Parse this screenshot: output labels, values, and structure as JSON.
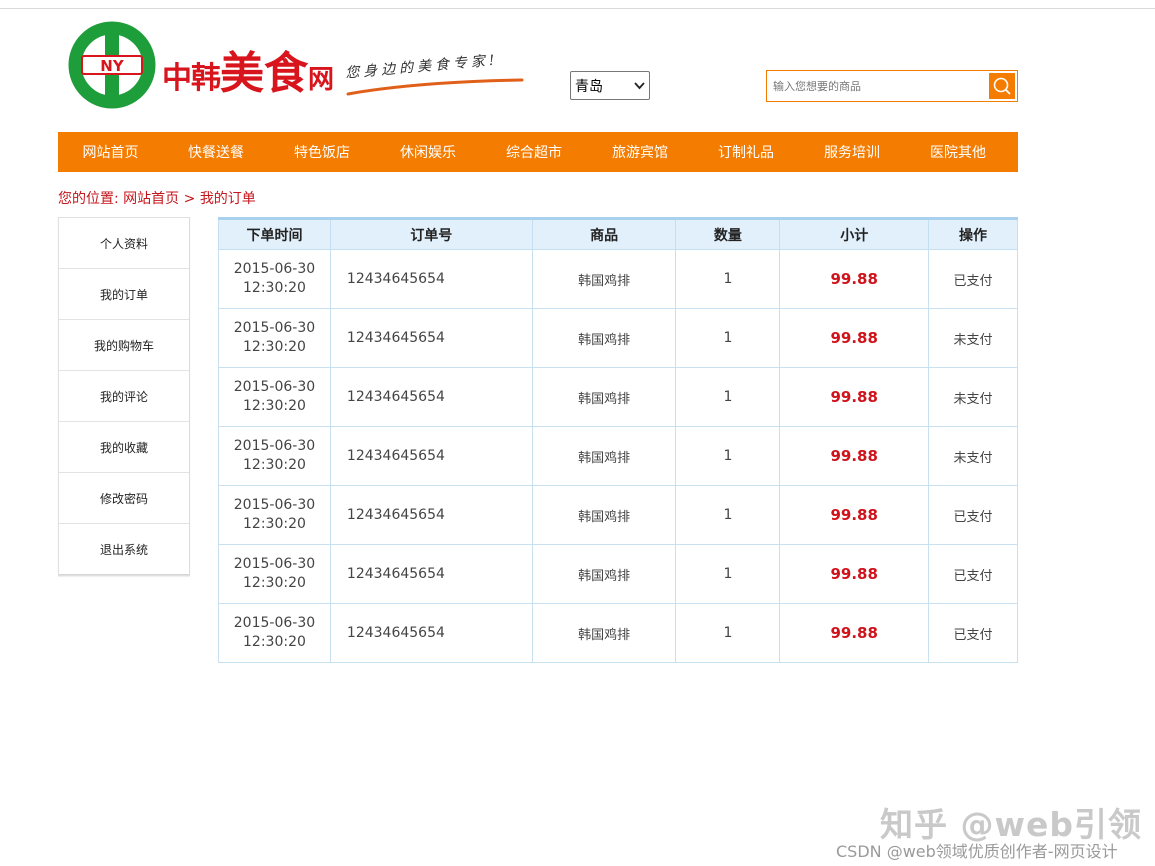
{
  "header": {
    "brand_part1": "中韩",
    "brand_part2": "美食",
    "brand_part3": "网",
    "logo_text": "NY",
    "slogan": "您身边的美食专家!",
    "city_selected": "青岛",
    "search_placeholder": "输入您想要的商品",
    "colors": {
      "brand_red": "#d8141c",
      "logo_green": "#1e9e3a",
      "accent_orange": "#f47c00"
    }
  },
  "nav": {
    "items": [
      "网站首页",
      "快餐送餐",
      "特色饭店",
      "休闲娱乐",
      "综合超市",
      "旅游宾馆",
      "订制礼品",
      "服务培训",
      "医院其他"
    ]
  },
  "breadcrumb": {
    "prefix": "您的位置:",
    "home": "网站首页",
    "separator": ">",
    "current": "我的订单"
  },
  "sidebar": {
    "items": [
      "个人资料",
      "我的订单",
      "我的购物车",
      "我的评论",
      "我的收藏",
      "修改密码",
      "退出系统"
    ]
  },
  "orders": {
    "headers": [
      "下单时间",
      "订单号",
      "商品",
      "数量",
      "小计",
      "操作"
    ],
    "rows": [
      {
        "date": "2015-06-30",
        "time": "12:30:20",
        "order_no": "12434645654",
        "goods": "韩国鸡排",
        "qty": "1",
        "subtotal": "99.88",
        "status": "已支付",
        "status_type": "paid"
      },
      {
        "date": "2015-06-30",
        "time": "12:30:20",
        "order_no": "12434645654",
        "goods": "韩国鸡排",
        "qty": "1",
        "subtotal": "99.88",
        "status": "未支付",
        "status_type": "unpaid"
      },
      {
        "date": "2015-06-30",
        "time": "12:30:20",
        "order_no": "12434645654",
        "goods": "韩国鸡排",
        "qty": "1",
        "subtotal": "99.88",
        "status": "未支付",
        "status_type": "unpaid"
      },
      {
        "date": "2015-06-30",
        "time": "12:30:20",
        "order_no": "12434645654",
        "goods": "韩国鸡排",
        "qty": "1",
        "subtotal": "99.88",
        "status": "未支付",
        "status_type": "unpaid"
      },
      {
        "date": "2015-06-30",
        "time": "12:30:20",
        "order_no": "12434645654",
        "goods": "韩国鸡排",
        "qty": "1",
        "subtotal": "99.88",
        "status": "已支付",
        "status_type": "paid"
      },
      {
        "date": "2015-06-30",
        "time": "12:30:20",
        "order_no": "12434645654",
        "goods": "韩国鸡排",
        "qty": "1",
        "subtotal": "99.88",
        "status": "已支付",
        "status_type": "paid"
      },
      {
        "date": "2015-06-30",
        "time": "12:30:20",
        "order_no": "12434645654",
        "goods": "韩国鸡排",
        "qty": "1",
        "subtotal": "99.88",
        "status": "已支付",
        "status_type": "paid"
      }
    ]
  },
  "watermark": {
    "line1": "知乎 @web引领",
    "line2": "CSDN @web领域优质创作者-网页设计"
  }
}
